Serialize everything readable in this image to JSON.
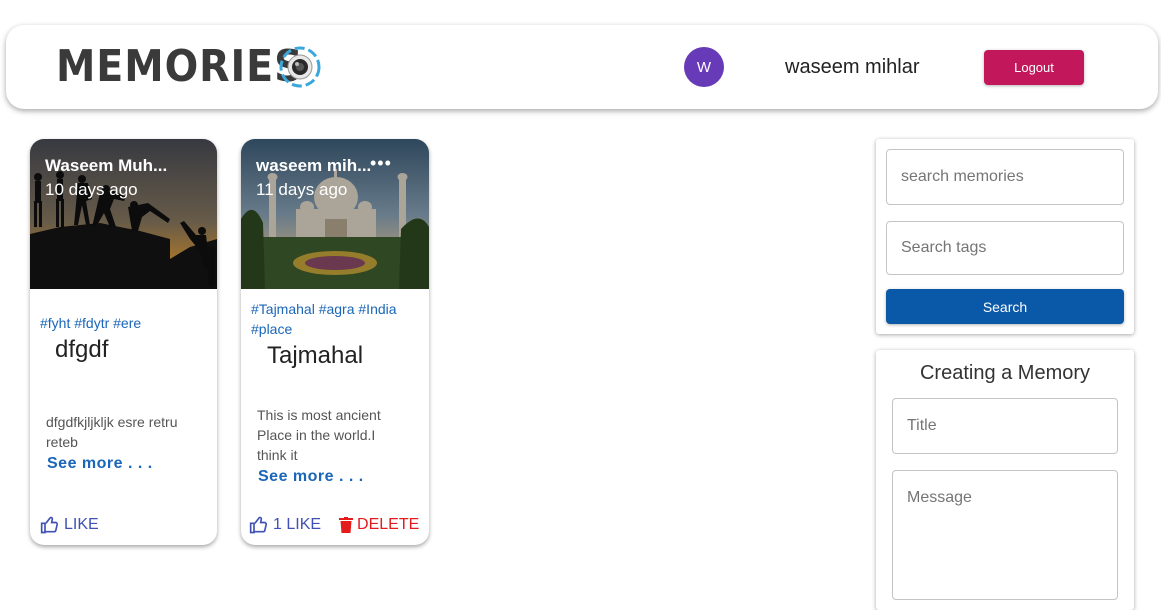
{
  "header": {
    "brand": "Memories",
    "avatar_initial": "W",
    "username": "waseem mihlar",
    "logout_label": "Logout"
  },
  "posts": [
    {
      "creator": "Waseem Muh...",
      "time": "10 days ago",
      "tags": "#fyht #fdytr #ere",
      "title": "dfgdf",
      "message": "dfgdfkjljkljk esre retru reteb",
      "see_more": "See more . . .",
      "like_label": "LIKE",
      "image_icon": "people-climbing-sunset-image"
    },
    {
      "creator": "waseem mih...",
      "time": "11 days ago",
      "more_icon": "more-horizontal-icon",
      "tags": "#Tajmahal #agra #India #place",
      "title": "Tajmahal",
      "message": "This is most ancient Place in the world.I think it",
      "see_more": "See more . . .",
      "like_label": "1 LIKE",
      "delete_label": "DELETE",
      "image_icon": "taj-mahal-image"
    }
  ],
  "search": {
    "memories_placeholder": "search memories",
    "tags_placeholder": "Search tags",
    "button_label": "Search"
  },
  "form": {
    "title": "Creating a Memory",
    "title_placeholder": "Title",
    "message_placeholder": "Message"
  },
  "colors": {
    "avatar": "#673ab7",
    "logout": "#c2185b",
    "search_button": "#0a58a8",
    "tag": "#1a66b8",
    "like": "#3f51b5",
    "delete": "#e31b1b"
  }
}
